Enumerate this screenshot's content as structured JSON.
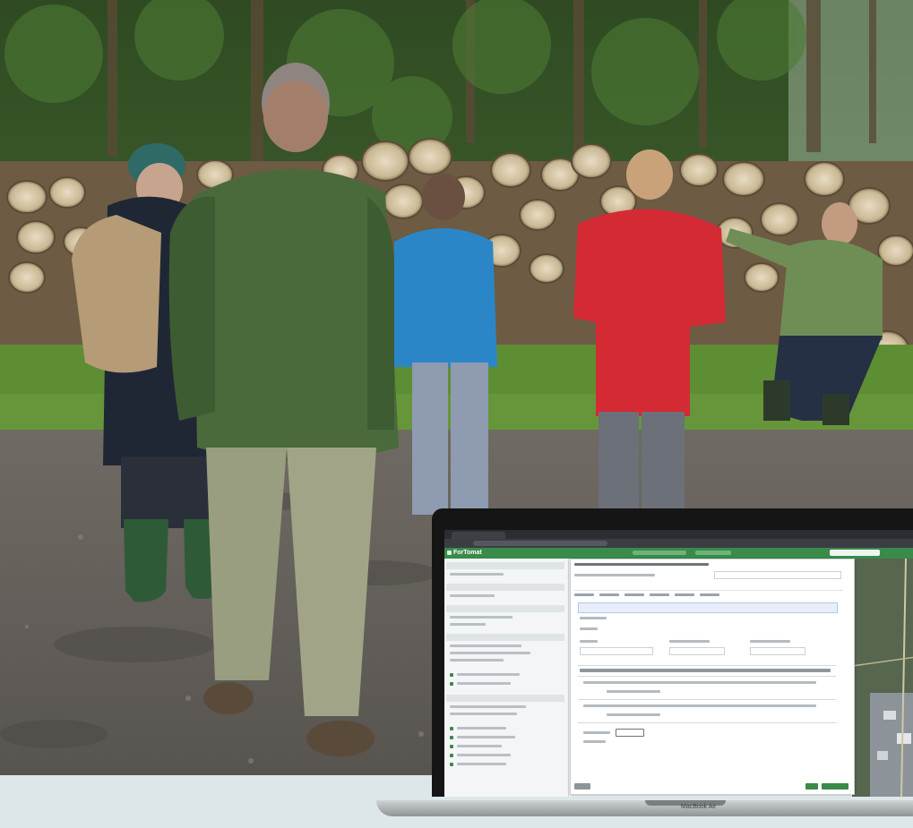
{
  "laptop": {
    "brand": "MacBook Air",
    "app_name": "ForTomat"
  },
  "colors": {
    "app_green": "#3a8a4a",
    "jacket_red": "#d42a34",
    "jacket_blue": "#2b86c8",
    "jacket_green": "#4a6a3c",
    "sky_band": "#dde6e9"
  }
}
